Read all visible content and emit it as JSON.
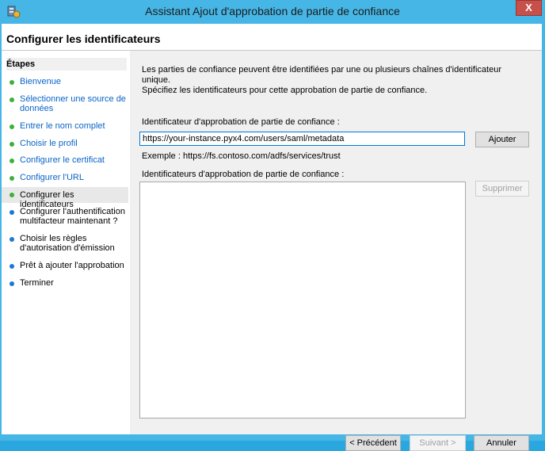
{
  "window": {
    "title": "Assistant Ajout d'approbation de partie de confiance",
    "close_label": "X"
  },
  "header": {
    "title": "Configurer les identificateurs"
  },
  "sidebar": {
    "heading": "Étapes",
    "steps": [
      {
        "label": "Bienvenue",
        "state": "done"
      },
      {
        "label": "Sélectionner une source de données",
        "state": "done"
      },
      {
        "label": "Entrer le nom complet",
        "state": "done"
      },
      {
        "label": "Choisir le profil",
        "state": "done"
      },
      {
        "label": "Configurer le certificat",
        "state": "done"
      },
      {
        "label": "Configurer l'URL",
        "state": "done"
      },
      {
        "label": "Configurer les identificateurs",
        "state": "current"
      },
      {
        "label": "Configurer l'authentification multifacteur maintenant ?",
        "state": "todo"
      },
      {
        "label": "Choisir les règles d'autorisation d'émission",
        "state": "todo"
      },
      {
        "label": "Prêt à ajouter l'approbation",
        "state": "todo"
      },
      {
        "label": "Terminer",
        "state": "todo"
      }
    ]
  },
  "main": {
    "intro_line1": "Les parties de confiance peuvent être identifiées par une ou plusieurs chaînes d'identificateur unique.",
    "intro_line2": "Spécifiez les identificateurs pour cette approbation de partie de confiance.",
    "identifier_label": "Identificateur d'approbation de partie de confiance :",
    "identifier_value": "https://your-instance.pyx4.com/users/saml/metadata",
    "add_button": "Ajouter",
    "example_text": "Exemple : https://fs.contoso.com/adfs/services/trust",
    "list_label": "Identificateurs d'approbation de partie de confiance :",
    "remove_button": "Supprimer"
  },
  "footer": {
    "previous": "< Précédent",
    "next": "Suivant >",
    "cancel": "Annuler"
  }
}
